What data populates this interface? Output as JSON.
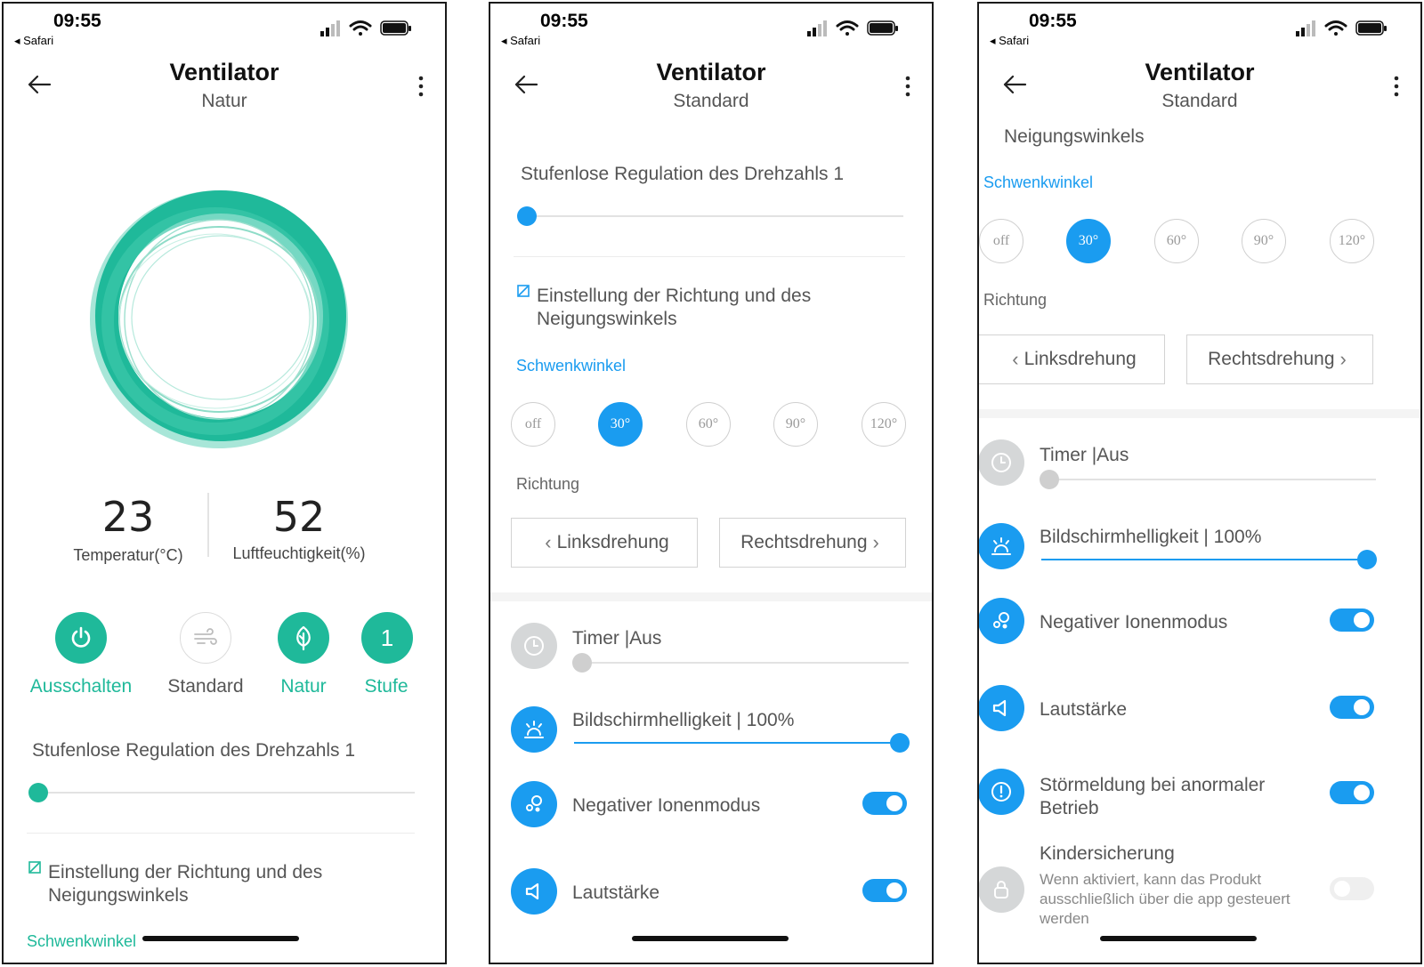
{
  "status_bar": {
    "time": "09:55",
    "back_app": "◂ Safari"
  },
  "colors": {
    "blue": "#1a9cf0",
    "teal": "#1fb99a",
    "gray": "#d5d7d8"
  },
  "screen1": {
    "title": "Ventilator",
    "subtitle": "Natur",
    "readings": [
      {
        "value": "23",
        "label": "Temperatur(°C)"
      },
      {
        "value": "52",
        "label": "Luftfeuchtigkeit(%)"
      }
    ],
    "controls": [
      {
        "label": "Ausschalten",
        "icon": "power-icon",
        "active": true
      },
      {
        "label": "Standard",
        "icon": "wind-icon",
        "active": false
      },
      {
        "label": "Natur",
        "icon": "leaf-icon",
        "active": true
      },
      {
        "label": "Stufe",
        "icon": "number-badge",
        "badge": "1",
        "active": true
      }
    ],
    "speed_label": "Stufenlose Regulation des Drehzahls 1",
    "speed_value": 0,
    "direction_heading": "Einstellung der Richtung und des Neigungswinkels",
    "swing_label": "Schwenkwinkel"
  },
  "screen2": {
    "title": "Ventilator",
    "subtitle": "Standard",
    "speed_label": "Stufenlose Regulation des Drehzahls 1",
    "speed_value": 0,
    "direction_heading": "Einstellung der Richtung und des Neigungswinkels",
    "swing_label": "Schwenkwinkel",
    "angles": [
      "off",
      "30°",
      "60°",
      "90°",
      "120°"
    ],
    "selected_angle": "30°",
    "direction_label": "Richtung",
    "left_button": "Linksdrehung",
    "right_button": "Rechtsdrehung",
    "timer_label": "Timer |Aus",
    "timer_value": 0,
    "brightness_label": "Bildschirmhelligkeit | 100%",
    "brightness_value": 1.0,
    "ion_label": "Negativer Ionenmodus",
    "ion_on": true,
    "volume_label": "Lautstärke",
    "volume_on": true
  },
  "screen3": {
    "title": "Ventilator",
    "subtitle": "Standard",
    "direction_heading_tail": "Neigungswinkels",
    "swing_label": "Schwenkwinkel",
    "angles": [
      "off",
      "30°",
      "60°",
      "90°",
      "120°"
    ],
    "selected_angle": "30°",
    "direction_label": "Richtung",
    "left_button": "Linksdrehung",
    "right_button": "Rechtsdrehung",
    "timer_label": "Timer |Aus",
    "timer_value": 0,
    "brightness_label": "Bildschirmhelligkeit | 100%",
    "brightness_value": 1.0,
    "ion_label": "Negativer Ionenmodus",
    "ion_on": true,
    "volume_label": "Lautstärke",
    "volume_on": true,
    "fault_label": "Störmeldung bei anormaler Betrieb",
    "fault_on": true,
    "child_lock_label": "Kindersicherung",
    "child_lock_desc": "Wenn aktiviert, kann das Produkt ausschließlich über die app gesteuert werden",
    "child_lock_on": false
  }
}
